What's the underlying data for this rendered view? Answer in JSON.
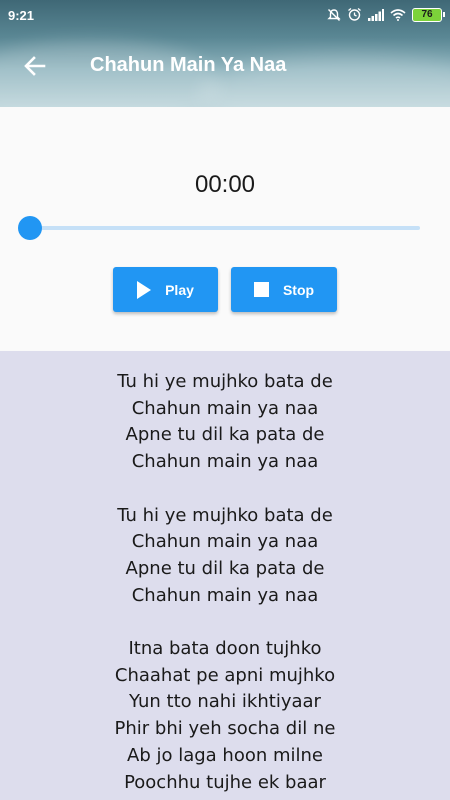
{
  "status_bar": {
    "time": "9:21",
    "battery": "76",
    "icons": [
      "mute-icon",
      "alarm-icon",
      "signal-icon",
      "wifi-icon",
      "battery-icon"
    ]
  },
  "header": {
    "title": "Chahun Main Ya Naa",
    "back_icon": "arrow-left-icon"
  },
  "player": {
    "time": "00:00",
    "progress": 0,
    "play_label": "Play",
    "stop_label": "Stop",
    "accent_color": "#2196f3"
  },
  "lyrics": {
    "text": "Tu hi ye mujhko bata de\nChahun main ya naa\nApne tu dil ka pata de\nChahun main ya naa\n\nTu hi ye mujhko bata de\nChahun main ya naa\nApne tu dil ka pata de\nChahun main ya naa\n\nItna bata doon tujhko\nChaahat pe apni mujhko\nYun tto nahi ikhtiyaar\nPhir bhi yeh socha dil ne\nAb jo laga hoon milne\nPoochhu tujhe ek baar"
  }
}
